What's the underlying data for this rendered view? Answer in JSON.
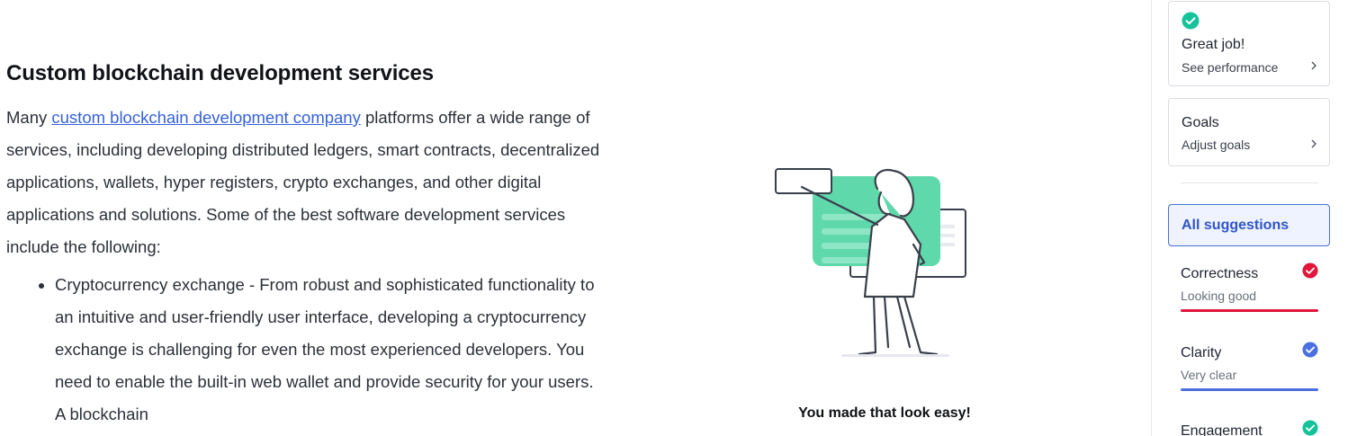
{
  "document": {
    "heading": "Custom blockchain development services",
    "para_before_link": "Many ",
    "link_text": "custom blockchain development company",
    "para_after_link": " platforms offer a wide range of services, including developing distributed ledgers, smart contracts, decentralized applications, wallets, hyper registers, crypto exchanges, and other digital applications and solutions. Some of the best software development services include the following:",
    "bullets": [
      "Cryptocurrency exchange - From robust and sophisticated functionality to an intuitive and user-friendly user interface, developing a cryptocurrency exchange is challenging for even the most experienced developers. You need to enable the built-in web wallet and provide security for your users. A blockchain"
    ]
  },
  "illustration": {
    "caption": "You made that look easy!"
  },
  "panel": {
    "score_card": {
      "icon": "check-circle-icon",
      "title": "Great job!",
      "subtitle": "See performance"
    },
    "goals_card": {
      "title": "Goals",
      "subtitle": "Adjust goals"
    },
    "all_suggestions": "All suggestions",
    "metrics": [
      {
        "title": "Correctness",
        "subtitle": "Looking good",
        "color": "#e0163b",
        "icon": "check-circle-icon"
      },
      {
        "title": "Clarity",
        "subtitle": "Very clear",
        "color": "#4c6fe0",
        "icon": "check-circle-icon"
      },
      {
        "title": "Engagement",
        "subtitle": "",
        "color": "#15b58a",
        "icon": "check-circle-icon"
      }
    ]
  },
  "colors": {
    "accent_blue": "#2f55c8",
    "success_green": "#15c39a",
    "correctness_red": "#e0163b",
    "clarity_blue": "#4c6fe0",
    "illustration_green": "#5fd8ac"
  }
}
